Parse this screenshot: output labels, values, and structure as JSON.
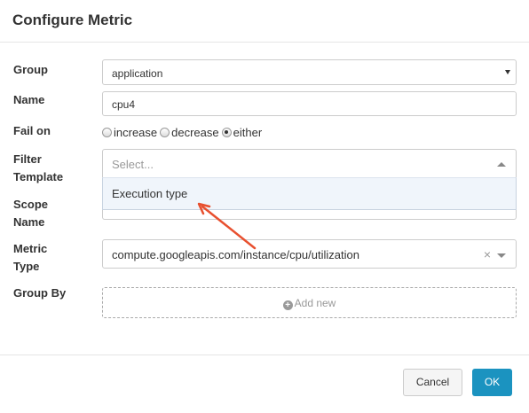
{
  "dialog": {
    "title": "Configure Metric"
  },
  "form": {
    "group": {
      "label": "Group",
      "value": "application"
    },
    "name": {
      "label": "Name",
      "value": "cpu4"
    },
    "fail_on": {
      "label": "Fail on",
      "options": [
        "increase",
        "decrease",
        "either"
      ],
      "selected": "either"
    },
    "filter_template": {
      "label_line1": "Filter",
      "label_line2": "Template",
      "placeholder": "Select...",
      "options": [
        "Execution type"
      ]
    },
    "scope_name": {
      "label_line1": "Scope",
      "label_line2": "Name"
    },
    "metric_type": {
      "label_line1": "Metric",
      "label_line2": "Type",
      "value": "compute.googleapis.com/instance/cpu/utilization",
      "clear": "×"
    },
    "group_by": {
      "label": "Group By",
      "add_label": "Add new"
    }
  },
  "footer": {
    "cancel_label": "Cancel",
    "ok_label": "OK"
  },
  "colors": {
    "primary": "#1b93c0",
    "annotation_arrow": "#e8502f",
    "dropdown_highlight": "#f0f5fb"
  },
  "icons": [
    "chevron-down-icon",
    "chevron-up-icon",
    "clear-icon",
    "plus-circle-icon",
    "arrow-annotation"
  ]
}
